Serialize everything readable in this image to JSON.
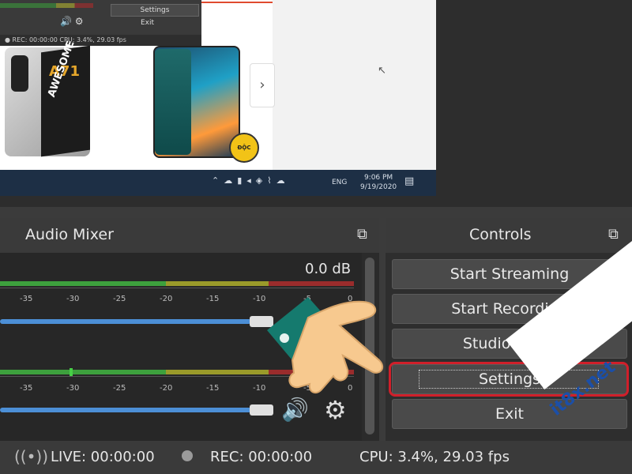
{
  "preview": {
    "mini_obs": {
      "settings_label": "Settings",
      "exit_label": "Exit",
      "status_text": "● REC: 00:00:00   CPU: 3.4%, 29.03 fps"
    },
    "product_model": "A71",
    "product_slogan": "AWESOME",
    "badge_text": "ĐỘC QUYỀN",
    "taskbar": {
      "lang": "ENG",
      "time": "9:06 PM",
      "date": "9/19/2020"
    }
  },
  "audio_mixer": {
    "title": "Audio Mixer",
    "db_value": "0.0 dB",
    "ticks": [
      "-35",
      "-30",
      "-25",
      "-20",
      "-15",
      "-10",
      "-5",
      "0"
    ]
  },
  "controls": {
    "title": "Controls",
    "buttons": [
      "Start Streaming",
      "Start Recording",
      "Studio Mode",
      "Settings",
      "Exit"
    ]
  },
  "status_bar": {
    "live": "LIVE: 00:00:00",
    "rec": "REC: 00:00:00",
    "cpu": "CPU: 3.4%, 29.03 fps"
  },
  "watermark": "it8x.net",
  "colors": {
    "highlight_red": "#d01f2a",
    "slider_blue": "#4c8fd6",
    "meter_green": "#3da03d",
    "meter_yellow": "#9a9a2a",
    "meter_red": "#9a2c2c"
  }
}
